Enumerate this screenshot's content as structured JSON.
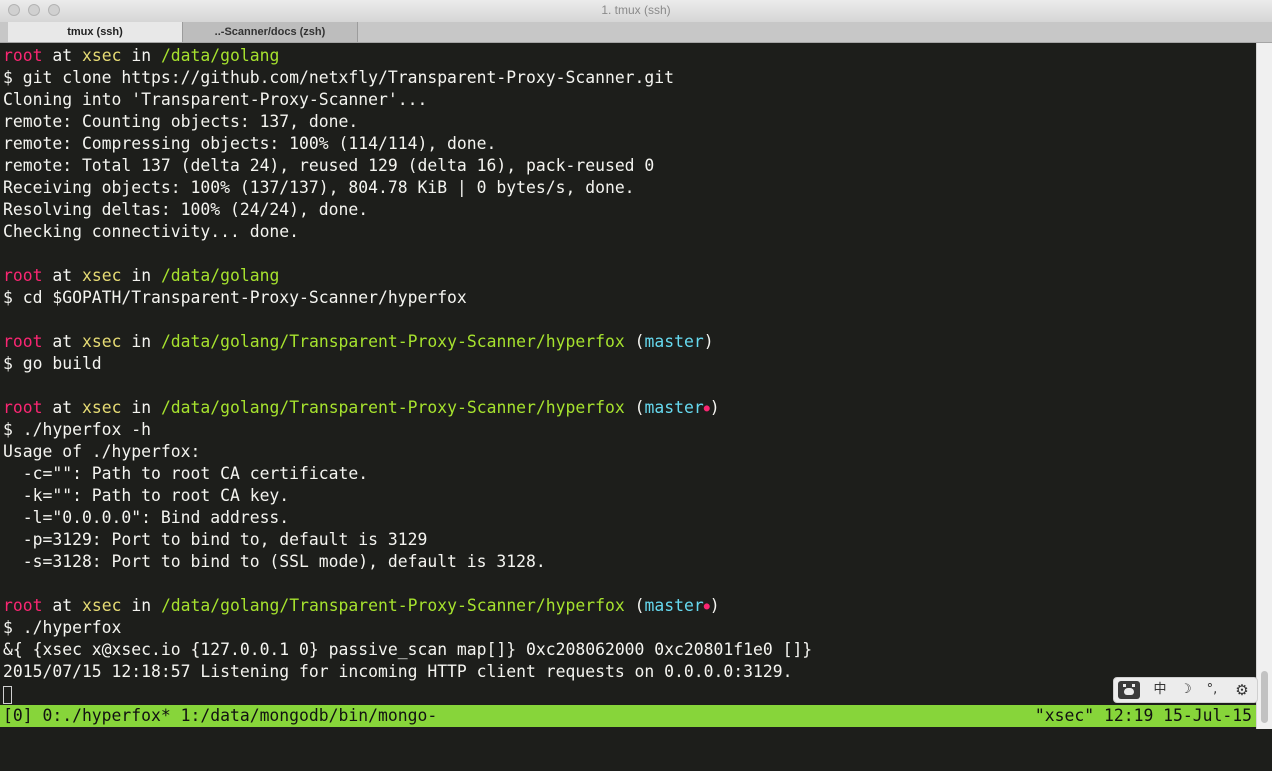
{
  "window": {
    "title": "1. tmux (ssh)"
  },
  "tabs": [
    {
      "label": "tmux (ssh)"
    },
    {
      "label": "..-Scanner/docs (zsh)"
    }
  ],
  "colors": {
    "user": "#f92672",
    "host": "#e6db74",
    "path": "#a6e22e",
    "branch": "#66d9ef",
    "background": "#1d1e1b",
    "statusbar": "#87d53a"
  },
  "terminal": {
    "lines": [
      {
        "type": "prompt",
        "user": "root",
        "at": " at ",
        "host": "xsec",
        "in": " in ",
        "path": "/data/golang"
      },
      {
        "type": "text",
        "text": "$ git clone https://github.com/netxfly/Transparent-Proxy-Scanner.git"
      },
      {
        "type": "text",
        "text": "Cloning into 'Transparent-Proxy-Scanner'..."
      },
      {
        "type": "text",
        "text": "remote: Counting objects: 137, done."
      },
      {
        "type": "text",
        "text": "remote: Compressing objects: 100% (114/114), done."
      },
      {
        "type": "text",
        "text": "remote: Total 137 (delta 24), reused 129 (delta 16), pack-reused 0"
      },
      {
        "type": "text",
        "text": "Receiving objects: 100% (137/137), 804.78 KiB | 0 bytes/s, done."
      },
      {
        "type": "text",
        "text": "Resolving deltas: 100% (24/24), done."
      },
      {
        "type": "text",
        "text": "Checking connectivity... done."
      },
      {
        "type": "blank"
      },
      {
        "type": "prompt",
        "user": "root",
        "at": " at ",
        "host": "xsec",
        "in": " in ",
        "path": "/data/golang"
      },
      {
        "type": "text",
        "text": "$ cd $GOPATH/Transparent-Proxy-Scanner/hyperfox"
      },
      {
        "type": "blank"
      },
      {
        "type": "prompt",
        "user": "root",
        "at": " at ",
        "host": "xsec",
        "in": " in ",
        "path": "/data/golang/Transparent-Proxy-Scanner/hyperfox",
        "open": " (",
        "branch": "master",
        "dirty": "",
        "close": ")"
      },
      {
        "type": "text",
        "text": "$ go build"
      },
      {
        "type": "blank"
      },
      {
        "type": "prompt",
        "user": "root",
        "at": " at ",
        "host": "xsec",
        "in": " in ",
        "path": "/data/golang/Transparent-Proxy-Scanner/hyperfox",
        "open": " (",
        "branch": "master",
        "dirty": "●",
        "close": ")"
      },
      {
        "type": "text",
        "text": "$ ./hyperfox -h"
      },
      {
        "type": "text",
        "text": "Usage of ./hyperfox:"
      },
      {
        "type": "text",
        "text": "  -c=\"\": Path to root CA certificate."
      },
      {
        "type": "text",
        "text": "  -k=\"\": Path to root CA key."
      },
      {
        "type": "text",
        "text": "  -l=\"0.0.0.0\": Bind address."
      },
      {
        "type": "text",
        "text": "  -p=3129: Port to bind to, default is 3129"
      },
      {
        "type": "text",
        "text": "  -s=3128: Port to bind to (SSL mode), default is 3128."
      },
      {
        "type": "blank"
      },
      {
        "type": "prompt",
        "user": "root",
        "at": " at ",
        "host": "xsec",
        "in": " in ",
        "path": "/data/golang/Transparent-Proxy-Scanner/hyperfox",
        "open": " (",
        "branch": "master",
        "dirty": "●",
        "close": ")"
      },
      {
        "type": "text",
        "text": "$ ./hyperfox"
      },
      {
        "type": "text",
        "text": "&{ {xsec x@xsec.io {127.0.0.1 0} passive_scan map[]} 0xc208062000 0xc20801f1e0 []}"
      },
      {
        "type": "text",
        "text": "2015/07/15 12:18:57 Listening for incoming HTTP client requests on 0.0.0.0:3129."
      }
    ]
  },
  "statusbar": {
    "left": "[0] 0:./hyperfox* 1:/data/mongodb/bin/mongo-",
    "right": "\"xsec\" 12:19 15-Jul-15"
  },
  "ime_toolbar": {
    "items": [
      {
        "icon": "paw-icon",
        "label": ""
      },
      {
        "icon": "chinese-mode-icon",
        "label": "中"
      },
      {
        "icon": "moon-icon",
        "label": "☽"
      },
      {
        "icon": "punctuation-icon",
        "label": "°,"
      },
      {
        "icon": "gear-icon",
        "label": "⚙"
      }
    ]
  }
}
